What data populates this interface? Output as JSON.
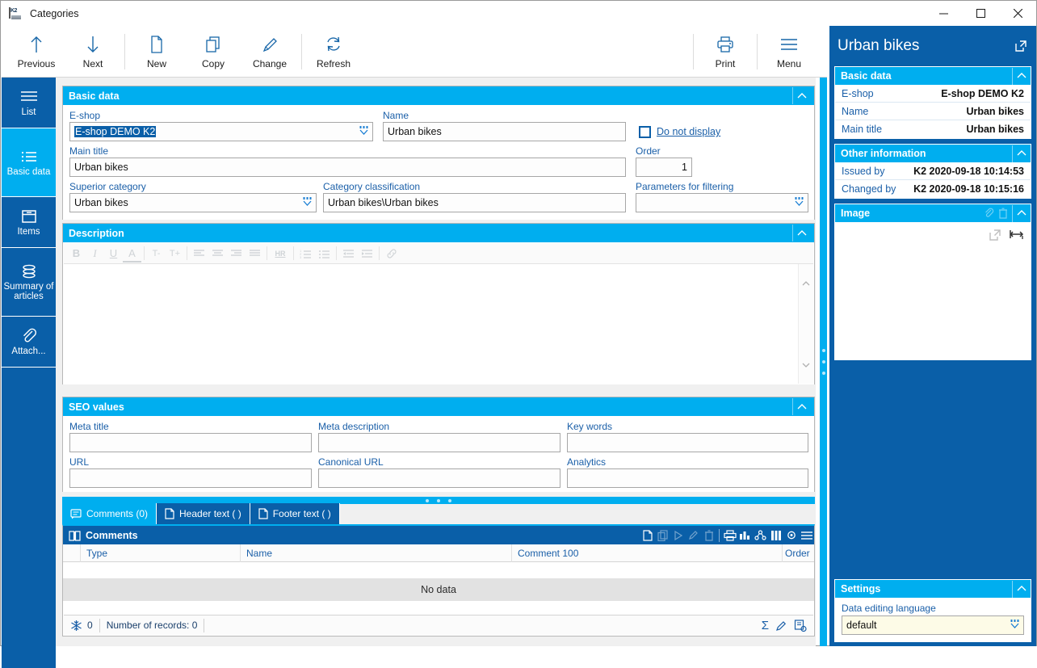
{
  "window": {
    "title": "Categories",
    "app_icon": "k2-app-icon",
    "controls": {
      "minimize": "—",
      "maximize": "□",
      "close": "✕"
    }
  },
  "ribbon": {
    "buttons": [
      {
        "label": "Previous",
        "icon": "arrow-up-icon"
      },
      {
        "label": "Next",
        "icon": "arrow-down-icon"
      },
      {
        "label": "New",
        "icon": "new-document-icon"
      },
      {
        "label": "Copy",
        "icon": "copy-icon"
      },
      {
        "label": "Change",
        "icon": "pencil-icon"
      },
      {
        "label": "Refresh",
        "icon": "refresh-icon"
      }
    ],
    "right_buttons": [
      {
        "label": "Print",
        "icon": "printer-icon"
      },
      {
        "label": "Menu",
        "icon": "hamburger-menu-icon"
      }
    ]
  },
  "sidebar": {
    "items": [
      {
        "label": "List",
        "icon": "list-icon",
        "active": false
      },
      {
        "label": "Basic data",
        "icon": "basic-data-icon",
        "active": true
      },
      {
        "label": "Items",
        "icon": "items-box-icon",
        "active": false
      },
      {
        "label": "Summary of articles",
        "icon": "stack-icon",
        "active": false
      },
      {
        "label": "Attach...",
        "icon": "paperclip-icon",
        "active": false
      }
    ]
  },
  "basic_data": {
    "title": "Basic data",
    "fields": {
      "eshop_label": "E-shop",
      "eshop_value": "E-shop DEMO K2",
      "name_label": "Name",
      "name_value": "Urban bikes",
      "do_not_display_label": "Do not display",
      "do_not_display_checked": false,
      "main_title_label": "Main title",
      "main_title_value": "Urban bikes",
      "order_label": "Order",
      "order_value": "1",
      "superior_category_label": "Superior category",
      "superior_category_value": "Urban bikes",
      "category_classification_label": "Category classification",
      "category_classification_value": "Urban bikes\\Urban bikes",
      "parameters_for_filtering_label": "Parameters for filtering",
      "parameters_for_filtering_value": ""
    }
  },
  "description": {
    "title": "Description",
    "content": "",
    "toolbar": [
      {
        "name": "bold-icon",
        "glyph": "B"
      },
      {
        "name": "italic-icon",
        "glyph": "I"
      },
      {
        "name": "underline-icon",
        "glyph": "U"
      },
      {
        "name": "font-color-icon",
        "glyph": "A"
      },
      {
        "name": "decrease-font-size-icon",
        "glyph": "T-"
      },
      {
        "name": "increase-font-size-icon",
        "glyph": "T+"
      },
      {
        "name": "align-left-icon",
        "glyph": "≡"
      },
      {
        "name": "align-center-icon",
        "glyph": "≡"
      },
      {
        "name": "align-right-icon",
        "glyph": "≡"
      },
      {
        "name": "align-justify-icon",
        "glyph": "≡"
      },
      {
        "name": "horizontal-rule-icon",
        "glyph": "HR"
      },
      {
        "name": "ordered-list-icon",
        "glyph": "≣"
      },
      {
        "name": "unordered-list-icon",
        "glyph": "≣"
      },
      {
        "name": "outdent-icon",
        "glyph": "≡"
      },
      {
        "name": "indent-icon",
        "glyph": "≡"
      },
      {
        "name": "hyperlink-icon",
        "glyph": "🔗"
      }
    ]
  },
  "seo": {
    "title": "SEO values",
    "fields": [
      {
        "label": "Meta title",
        "value": ""
      },
      {
        "label": "Meta description",
        "value": ""
      },
      {
        "label": "Key words",
        "value": ""
      },
      {
        "label": "URL",
        "value": ""
      },
      {
        "label": "Canonical URL",
        "value": ""
      },
      {
        "label": "Analytics",
        "value": ""
      }
    ]
  },
  "bottom_tabs": [
    {
      "label": "Comments (0)",
      "icon": "comment-bubble-icon",
      "active": true
    },
    {
      "label": "Header text ( )",
      "icon": "document-icon",
      "active": false
    },
    {
      "label": "Footer text ( )",
      "icon": "document-icon",
      "active": false
    }
  ],
  "comments_grid": {
    "title": "Comments",
    "title_icon": "book-icon",
    "toolbar": [
      {
        "name": "new-record-icon",
        "disabled": false
      },
      {
        "name": "copy-record-icon",
        "disabled": true
      },
      {
        "name": "run-icon",
        "disabled": true
      },
      {
        "name": "edit-record-icon",
        "disabled": true
      },
      {
        "name": "delete-record-icon",
        "disabled": true
      },
      {
        "name": "print-grid-icon",
        "disabled": false
      },
      {
        "name": "chart-icon",
        "disabled": false
      },
      {
        "name": "tree-view-icon",
        "disabled": false
      },
      {
        "name": "columns-icon",
        "disabled": false
      },
      {
        "name": "settings-gear-icon",
        "disabled": false
      },
      {
        "name": "grid-menu-icon",
        "disabled": false
      }
    ],
    "columns": [
      "Type",
      "Name",
      "Comment 100",
      "Order"
    ],
    "rows": [],
    "empty_text": "No data",
    "status": {
      "snowflake_count": "0",
      "records_label": "Number of records: 0",
      "tools": [
        "sum-sigma-icon",
        "edit-pencil-icon",
        "export-icon"
      ]
    }
  },
  "right_panel": {
    "title": "Urban bikes",
    "expand_icon": "open-external-icon",
    "sections": [
      {
        "title": "Basic data",
        "rows": [
          {
            "key": "E-shop",
            "value": "E-shop DEMO K2"
          },
          {
            "key": "Name",
            "value": "Urban bikes"
          },
          {
            "key": "Main title",
            "value": "Urban bikes"
          }
        ]
      },
      {
        "title": "Other information",
        "rows": [
          {
            "key": "Issued by",
            "value": "K2 2020-09-18 10:14:53"
          },
          {
            "key": "Changed by",
            "value": "K2 2020-09-18 10:15:16"
          }
        ]
      }
    ],
    "image_section": {
      "title": "Image",
      "tools": [
        "attach-icon",
        "delete-icon"
      ],
      "overlay_icons": [
        "open-external-icon",
        "fit-width-icon"
      ]
    },
    "settings_section": {
      "title": "Settings",
      "language_label": "Data editing language",
      "language_value": "default"
    }
  },
  "colors": {
    "accent_cyan": "#00aeef",
    "accent_blue": "#0a5fa8",
    "label_blue": "#1a5fa8",
    "panel_bg": "#f0f0f0",
    "combo_highlight": "#0a5fa8",
    "settings_combo_bg": "#fdfbe7"
  }
}
